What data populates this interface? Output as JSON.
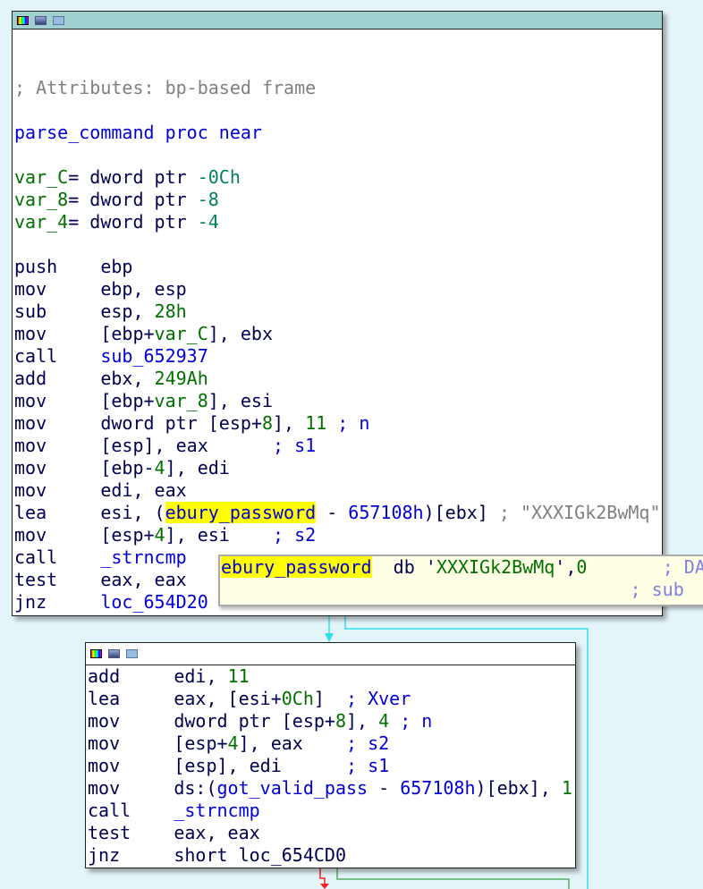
{
  "top_block": {
    "lines": [
      [],
      [],
      [
        [
          "; Attributes: bp-based frame",
          "c"
        ]
      ],
      [],
      [
        [
          "parse_command proc near",
          "n"
        ]
      ],
      [],
      [
        [
          "var_C",
          "v"
        ],
        [
          "= dword ptr ",
          "o"
        ],
        [
          "-0Ch",
          "t"
        ]
      ],
      [
        [
          "var_8",
          "v"
        ],
        [
          "= dword ptr ",
          "o"
        ],
        [
          "-8",
          "t"
        ]
      ],
      [
        [
          "var_4",
          "v"
        ],
        [
          "= dword ptr ",
          "o"
        ],
        [
          "-4",
          "t"
        ]
      ],
      [],
      [
        [
          "push    ",
          "m"
        ],
        [
          "ebp",
          "o"
        ]
      ],
      [
        [
          "mov     ",
          "m"
        ],
        [
          "ebp, esp",
          "o"
        ]
      ],
      [
        [
          "sub     ",
          "m"
        ],
        [
          "esp, ",
          "o"
        ],
        [
          "28h",
          "g"
        ]
      ],
      [
        [
          "mov     ",
          "m"
        ],
        [
          "[ebp+",
          "o"
        ],
        [
          "var_C",
          "v"
        ],
        [
          "], ebx",
          "o"
        ]
      ],
      [
        [
          "call    ",
          "m"
        ],
        [
          "sub_652937",
          "n"
        ]
      ],
      [
        [
          "add     ",
          "m"
        ],
        [
          "ebx, ",
          "o"
        ],
        [
          "249Ah",
          "g"
        ]
      ],
      [
        [
          "mov     ",
          "m"
        ],
        [
          "[ebp+",
          "o"
        ],
        [
          "var_8",
          "v"
        ],
        [
          "], esi",
          "o"
        ]
      ],
      [
        [
          "mov     ",
          "m"
        ],
        [
          "dword ptr [esp+",
          "o"
        ],
        [
          "8",
          "g"
        ],
        [
          "], ",
          "o"
        ],
        [
          "11",
          "g"
        ],
        [
          " ; n",
          "cb"
        ]
      ],
      [
        [
          "mov     ",
          "m"
        ],
        [
          "[esp], eax      ",
          "o"
        ],
        [
          "; s1",
          "cb"
        ]
      ],
      [
        [
          "mov     ",
          "m"
        ],
        [
          "[ebp-",
          "o"
        ],
        [
          "4",
          "g"
        ],
        [
          "], edi",
          "o"
        ]
      ],
      [
        [
          "mov     ",
          "m"
        ],
        [
          "edi, eax",
          "o"
        ]
      ],
      [
        [
          "lea     ",
          "m"
        ],
        [
          "esi, (",
          "o"
        ],
        [
          "ebury_password",
          "h"
        ],
        [
          " - ",
          "o"
        ],
        [
          "657108h",
          "n"
        ],
        [
          ")[ebx] ",
          "o"
        ],
        [
          "; \"XXXIGk2BwMq\"",
          "c"
        ]
      ],
      [
        [
          "mov     ",
          "m"
        ],
        [
          "[esp+",
          "o"
        ],
        [
          "4",
          "g"
        ],
        [
          "], esi    ",
          "o"
        ],
        [
          "; s2",
          "cb"
        ]
      ],
      [
        [
          "call    ",
          "m"
        ],
        [
          "_strncmp",
          "n"
        ]
      ],
      [
        [
          "test    ",
          "m"
        ],
        [
          "eax, eax",
          "o"
        ]
      ],
      [
        [
          "jnz     ",
          "m"
        ],
        [
          "loc_654D20",
          "n"
        ]
      ]
    ]
  },
  "tooltip": {
    "lines": [
      [
        [
          "ebury_password",
          "h"
        ],
        [
          "  db '",
          "o"
        ],
        [
          "XXXIGk2BwMq",
          "g"
        ],
        [
          "',",
          "o"
        ],
        [
          "0",
          "g"
        ],
        [
          "       ; DAT",
          "tc"
        ]
      ],
      [
        [
          "                                      ; sub",
          "tc"
        ]
      ]
    ]
  },
  "bottom_block": {
    "lines": [
      [
        [
          "add     ",
          "m"
        ],
        [
          "edi, ",
          "o"
        ],
        [
          "11",
          "g"
        ]
      ],
      [
        [
          "lea     ",
          "m"
        ],
        [
          "eax, [esi+",
          "o"
        ],
        [
          "0Ch",
          "g"
        ],
        [
          "]  ",
          "o"
        ],
        [
          "; Xver",
          "cb"
        ]
      ],
      [
        [
          "mov     ",
          "m"
        ],
        [
          "dword ptr [esp+",
          "o"
        ],
        [
          "8",
          "g"
        ],
        [
          "], ",
          "o"
        ],
        [
          "4",
          "g"
        ],
        [
          " ; n",
          "cb"
        ]
      ],
      [
        [
          "mov     ",
          "m"
        ],
        [
          "[esp+",
          "o"
        ],
        [
          "4",
          "g"
        ],
        [
          "], eax    ",
          "o"
        ],
        [
          "; s2",
          "cb"
        ]
      ],
      [
        [
          "mov     ",
          "m"
        ],
        [
          "[esp], edi      ",
          "o"
        ],
        [
          "; s1",
          "cb"
        ]
      ],
      [
        [
          "mov     ",
          "m"
        ],
        [
          "ds:(",
          "o"
        ],
        [
          "got_valid_pass",
          "n"
        ],
        [
          " - ",
          "o"
        ],
        [
          "657108h",
          "n"
        ],
        [
          ")[ebx], ",
          "o"
        ],
        [
          "1",
          "g"
        ]
      ],
      [
        [
          "call    ",
          "m"
        ],
        [
          "_strncmp",
          "n"
        ]
      ],
      [
        [
          "test    ",
          "m"
        ],
        [
          "eax, eax",
          "o"
        ]
      ],
      [
        [
          "jnz     ",
          "m"
        ],
        [
          "short loc_654CD0",
          "o"
        ]
      ]
    ]
  },
  "colors": {
    "edge_cyan": "#30e0f0",
    "edge_green": "#50b060",
    "edge_red": "#ff2020",
    "background": "#e4f5fa"
  }
}
